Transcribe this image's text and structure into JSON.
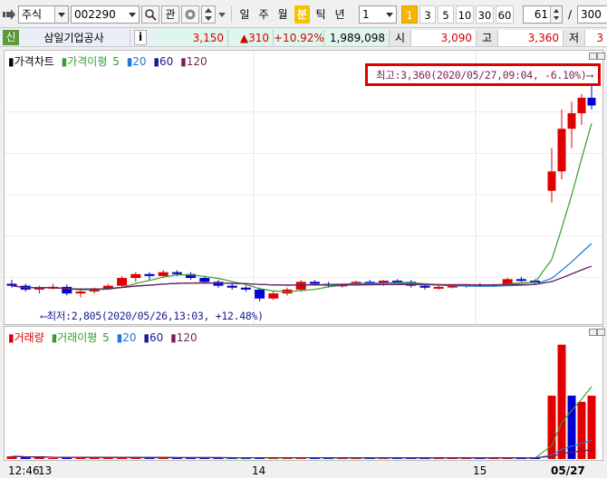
{
  "toolbar": {
    "market": "주식",
    "code": "002290",
    "btn_watch": "관",
    "periods": [
      "일",
      "주",
      "월",
      "분",
      "틱",
      "년"
    ],
    "active_period": "분",
    "interval": "1",
    "quick_intervals": [
      "1",
      "3",
      "5",
      "10",
      "30",
      "60"
    ],
    "active_quick": "1",
    "count_input": "61",
    "count_sep": "/",
    "count_total": "300"
  },
  "quote": {
    "market_badge": "신",
    "name": "삼일기업공사",
    "info_btn": "i",
    "price": "3,150",
    "change": "▲310",
    "change_pct": "+10.92%",
    "volume": "1,989,098",
    "open_label": "시",
    "open": "3,090",
    "high_label": "고",
    "high": "3,360",
    "low_label": "저",
    "low": "3"
  },
  "price_panel": {
    "legend_main": "가격차트",
    "legend_ma_label": "가격이평",
    "ma": [
      "5",
      "20",
      "60",
      "120"
    ],
    "max_annotation": "최고:3,360(2020/05/27,09:04, -6.10%)⟶",
    "min_annotation": "⟵최저:2,805(2020/05/26,13:03, +12.48%)"
  },
  "volume_panel": {
    "legend_main": "거래량",
    "legend_ma_label": "거래이평",
    "ma": [
      "5",
      "20",
      "60",
      "120"
    ]
  },
  "xaxis": {
    "labels": [
      "12:46",
      "13",
      "14",
      "15",
      "05/27"
    ]
  },
  "colors": {
    "up": "#e00000",
    "down": "#0000d0",
    "ma5": "#33a02c",
    "ma20": "#1f78d4",
    "ma60": "#1a1a8c",
    "ma120": "#7a1f5a",
    "highlight": "#e00000"
  },
  "chart_data": {
    "type": "candlestick",
    "title": "",
    "ylim": [
      2760,
      3400
    ],
    "candles": [
      [
        2850,
        2860,
        2840,
        2845
      ],
      [
        2845,
        2850,
        2830,
        2835
      ],
      [
        2835,
        2845,
        2825,
        2840
      ],
      [
        2840,
        2850,
        2835,
        2842
      ],
      [
        2842,
        2848,
        2820,
        2825
      ],
      [
        2825,
        2835,
        2815,
        2830
      ],
      [
        2830,
        2840,
        2825,
        2838
      ],
      [
        2838,
        2850,
        2835,
        2845
      ],
      [
        2845,
        2870,
        2840,
        2865
      ],
      [
        2865,
        2880,
        2855,
        2875
      ],
      [
        2875,
        2880,
        2860,
        2870
      ],
      [
        2870,
        2885,
        2865,
        2880
      ],
      [
        2880,
        2885,
        2870,
        2875
      ],
      [
        2875,
        2880,
        2860,
        2865
      ],
      [
        2865,
        2870,
        2850,
        2855
      ],
      [
        2855,
        2860,
        2840,
        2845
      ],
      [
        2845,
        2850,
        2835,
        2840
      ],
      [
        2840,
        2845,
        2830,
        2835
      ],
      [
        2835,
        2840,
        2805,
        2812
      ],
      [
        2812,
        2830,
        2808,
        2825
      ],
      [
        2825,
        2840,
        2820,
        2835
      ],
      [
        2835,
        2860,
        2830,
        2855
      ],
      [
        2855,
        2860,
        2845,
        2850
      ],
      [
        2850,
        2855,
        2840,
        2845
      ],
      [
        2845,
        2850,
        2840,
        2848
      ],
      [
        2848,
        2858,
        2845,
        2855
      ],
      [
        2855,
        2860,
        2850,
        2852
      ],
      [
        2852,
        2860,
        2845,
        2858
      ],
      [
        2858,
        2862,
        2850,
        2855
      ],
      [
        2855,
        2860,
        2840,
        2845
      ],
      [
        2845,
        2850,
        2835,
        2840
      ],
      [
        2840,
        2845,
        2835,
        2842
      ],
      [
        2842,
        2848,
        2838,
        2845
      ],
      [
        2845,
        2850,
        2840,
        2848
      ],
      [
        2848,
        2852,
        2842,
        2845
      ],
      [
        2845,
        2850,
        2842,
        2848
      ],
      [
        2848,
        2865,
        2846,
        2862
      ],
      [
        2862,
        2868,
        2855,
        2858
      ],
      [
        2858,
        2862,
        2850,
        2855
      ],
      [
        3090,
        3200,
        3060,
        3140
      ],
      [
        3140,
        3300,
        3120,
        3250
      ],
      [
        3250,
        3320,
        3200,
        3290
      ],
      [
        3290,
        3340,
        3260,
        3330
      ],
      [
        3330,
        3360,
        3300,
        3310
      ]
    ],
    "volume": [
      3,
      2,
      2,
      1,
      2,
      2,
      1,
      2,
      1,
      2,
      1,
      2,
      1,
      1,
      2,
      1,
      1,
      1,
      2,
      1,
      1,
      2,
      1,
      1,
      1,
      1,
      1,
      1,
      1,
      1,
      1,
      1,
      1,
      1,
      1,
      1,
      1,
      1,
      1,
      72,
      130,
      72,
      65,
      72
    ],
    "volume_direction": [
      "u",
      "d",
      "u",
      "u",
      "d",
      "u",
      "u",
      "u",
      "u",
      "u",
      "d",
      "u",
      "d",
      "d",
      "d",
      "d",
      "d",
      "d",
      "d",
      "u",
      "u",
      "u",
      "d",
      "d",
      "u",
      "u",
      "d",
      "u",
      "d",
      "d",
      "d",
      "u",
      "u",
      "u",
      "d",
      "u",
      "u",
      "d",
      "d",
      "u",
      "u",
      "d",
      "u",
      "u"
    ]
  }
}
